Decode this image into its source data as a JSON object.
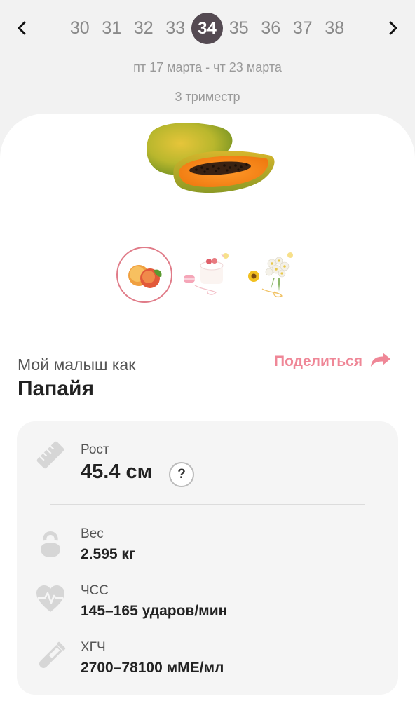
{
  "weeks": {
    "items": [
      "30",
      "31",
      "32",
      "33",
      "34",
      "35",
      "36",
      "37",
      "38"
    ],
    "active": "34"
  },
  "date_range": "пт 17 марта - чт 23 марта",
  "trimester": "3 триместр",
  "baby": {
    "subtitle": "Мой малыш как",
    "fruit": "Папайя",
    "share_label": "Поделиться"
  },
  "thumbnails": [
    {
      "name": "peach",
      "active": true
    },
    {
      "name": "cake",
      "active": false
    },
    {
      "name": "bouquet",
      "active": false
    }
  ],
  "stats": {
    "height": {
      "label": "Рост",
      "value": "45.4 см",
      "help": "?"
    },
    "weight": {
      "label": "Вес",
      "value": "2.595 кг"
    },
    "heart_rate": {
      "label": "ЧСС",
      "value": "145–165 ударов/мин"
    },
    "hcg": {
      "label": "ХГЧ",
      "value": "2700–78100 мМЕ/мл"
    }
  },
  "colors": {
    "accent": "#ef8797",
    "active_week": "#544a52",
    "icon_gray": "#d6d6d6"
  }
}
